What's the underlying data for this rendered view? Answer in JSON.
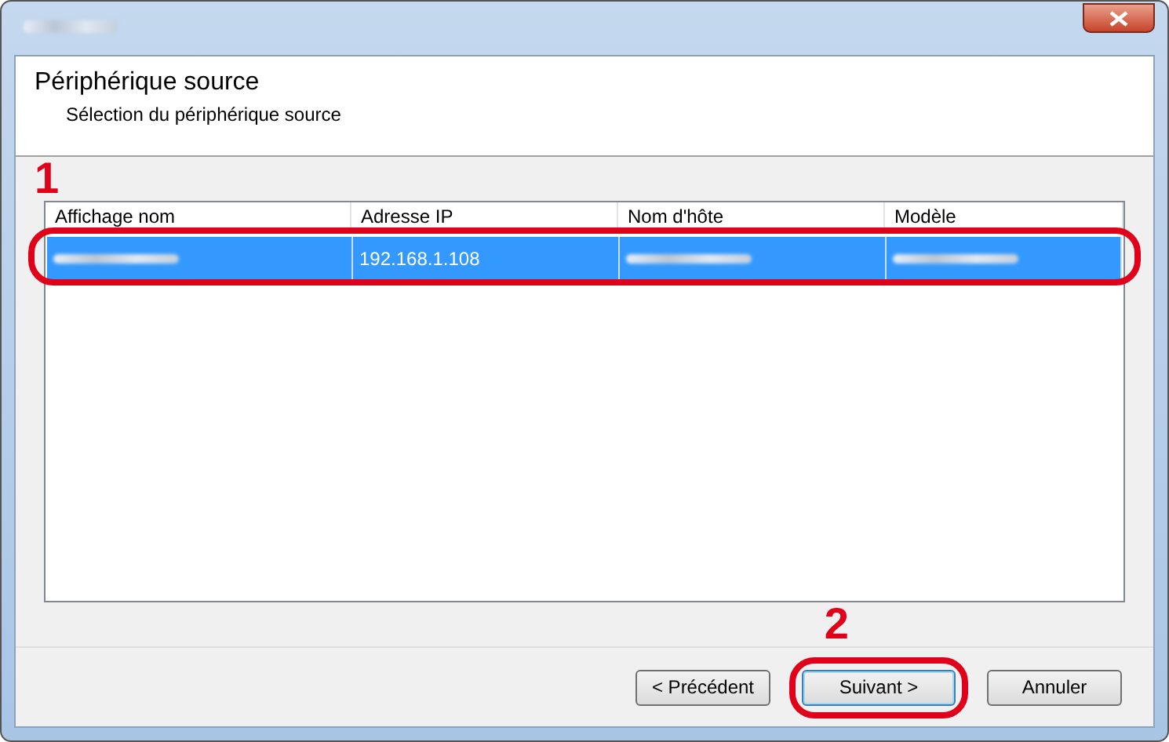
{
  "header": {
    "title": "Périphérique source",
    "subtitle": "Sélection du périphérique source"
  },
  "annotations": [
    {
      "label": "1"
    },
    {
      "label": "2"
    }
  ],
  "table": {
    "columns": [
      "Affichage nom",
      "Adresse IP",
      "Nom d'hôte",
      "Modèle"
    ],
    "rows": [
      {
        "selected": true,
        "cells": [
          {
            "kind": "redacted"
          },
          {
            "kind": "text",
            "text": "192.168.1.108"
          },
          {
            "kind": "redacted"
          },
          {
            "kind": "redacted"
          }
        ]
      }
    ]
  },
  "buttons": [
    {
      "label": "< Précédent",
      "focused": false
    },
    {
      "label": "Suivant >",
      "focused": true
    },
    {
      "label": "Annuler",
      "focused": false
    }
  ]
}
